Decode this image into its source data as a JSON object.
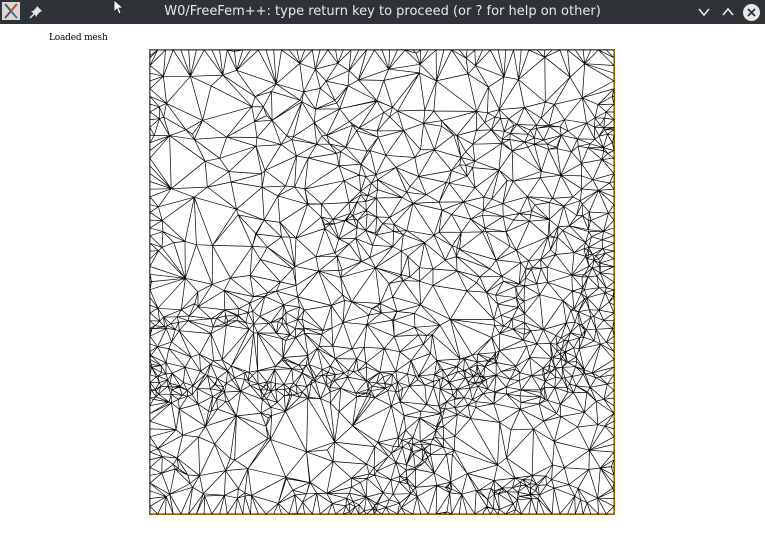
{
  "window": {
    "title": "W0/FreeFem++: type return key to proceed (or ? for help on other)",
    "icons": {
      "app": "freefem-app-icon",
      "pin": "pin-icon",
      "minimize": "chevron-down-icon",
      "maximize": "chevron-up-icon",
      "close": "close-icon"
    },
    "colors": {
      "titlebar_bg": "#2f3338",
      "title_text": "#e9e9e9",
      "mesh_border": "#8a5a00",
      "mesh_lines": "#000000"
    }
  },
  "plot": {
    "label": "Loaded mesh"
  }
}
